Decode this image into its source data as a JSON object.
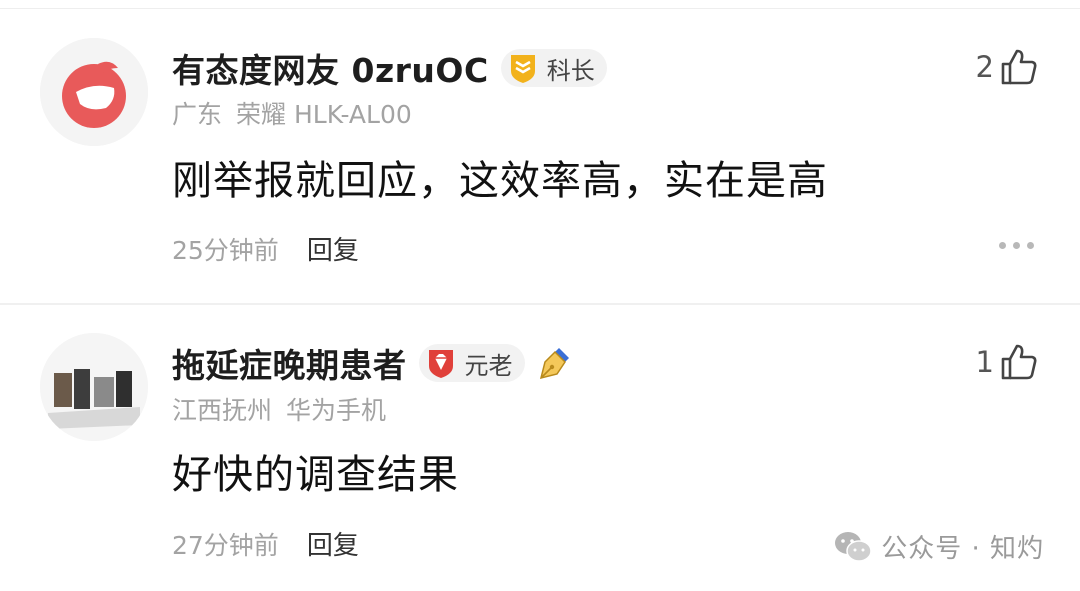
{
  "comments": [
    {
      "username": "有态度网友 0zruOC",
      "badge_label": "科长",
      "badge_icon": "rank-shield-icon",
      "location": "广东",
      "device": "荣耀 HLK-AL00",
      "content": "刚举报就回应，这效率高，实在是高",
      "time": "25分钟前",
      "reply_label": "回复",
      "likes": "2",
      "avatar_color": "#e85a5a"
    },
    {
      "username": "拖延症晚期患者",
      "badge_label": "元老",
      "badge_icon": "gem-shield-icon",
      "location": "江西抚州",
      "device": "华为手机",
      "content": "好快的调查结果",
      "time": "27分钟前",
      "reply_label": "回复",
      "likes": "1"
    }
  ],
  "watermark": {
    "text": "公众号 · 知灼",
    "icon": "wechat-icon"
  },
  "colors": {
    "muted": "#a3a3a3",
    "badge_gold": "#f2b21c",
    "badge_red": "#e0403a"
  }
}
